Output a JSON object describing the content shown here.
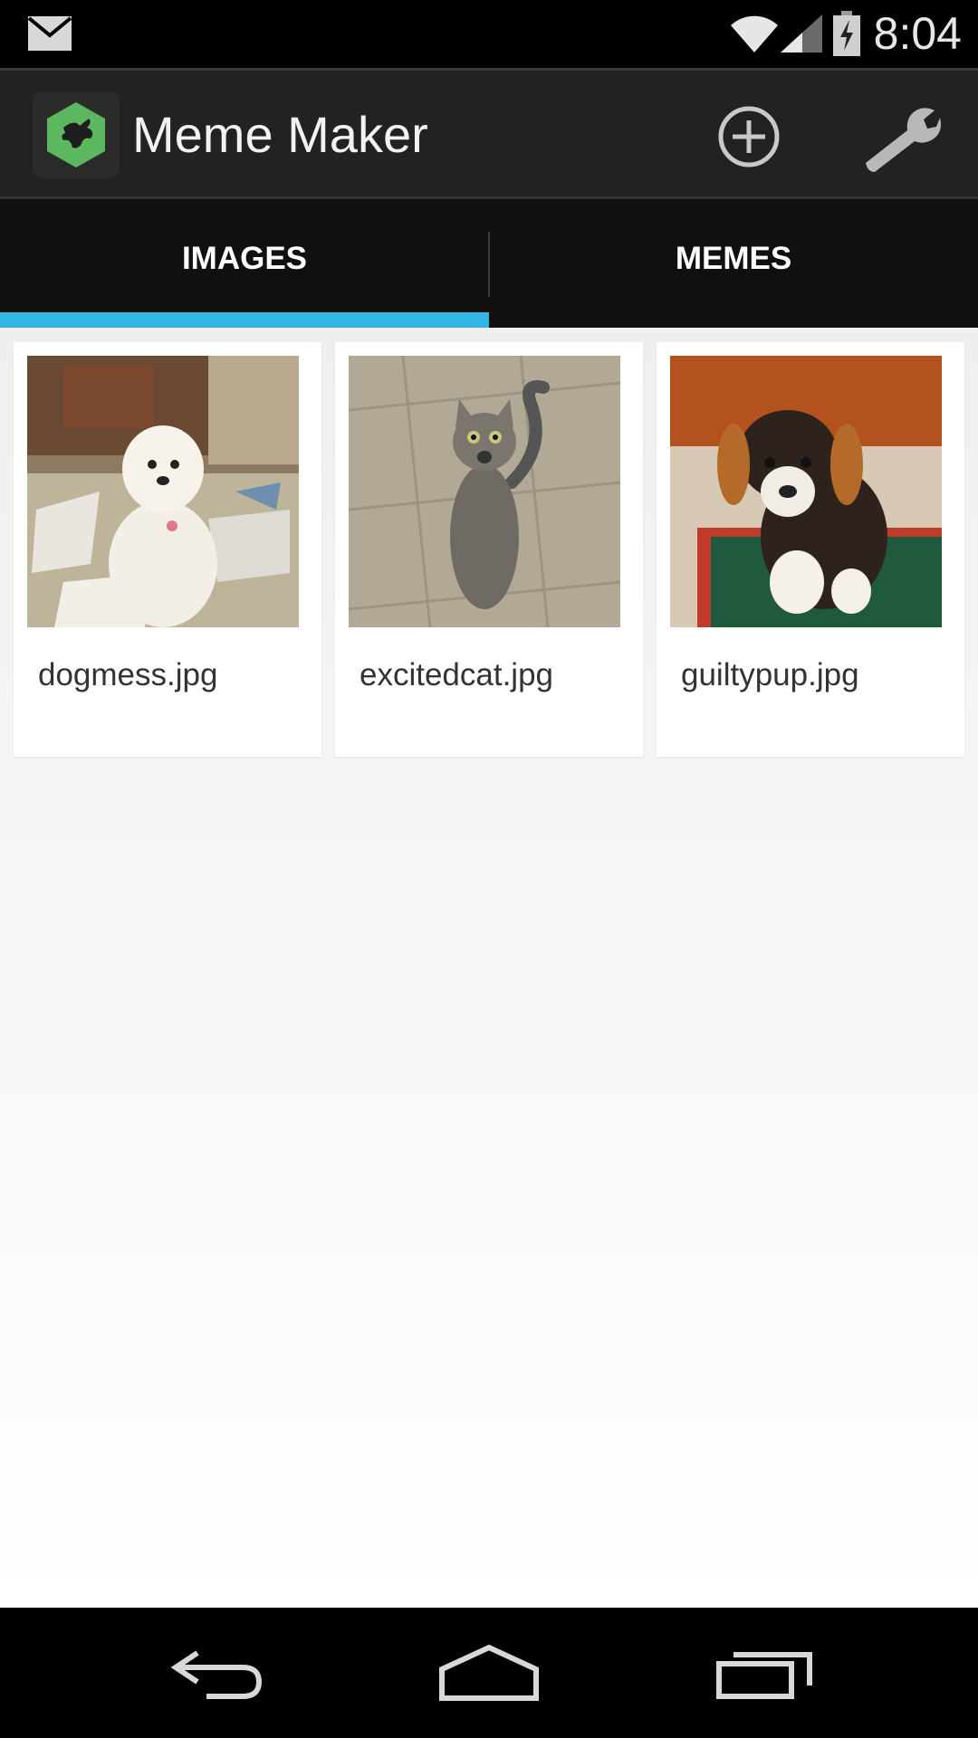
{
  "status_bar": {
    "time": "8:04",
    "icons": [
      "mail-icon",
      "wifi-icon",
      "signal-icon",
      "battery-charging-icon"
    ]
  },
  "action_bar": {
    "title": "Meme Maker",
    "app_icon": "treehouse-logo-icon",
    "actions": [
      "add-icon",
      "wrench-icon"
    ],
    "accent_color": "#5cb860"
  },
  "tabs": {
    "items": [
      {
        "label": "IMAGES",
        "selected": true
      },
      {
        "label": "MEMES",
        "selected": false
      }
    ],
    "indicator_color": "#33b5e5"
  },
  "images": [
    {
      "filename": "dogmess.jpg"
    },
    {
      "filename": "excitedcat.jpg"
    },
    {
      "filename": "guiltypup.jpg"
    }
  ],
  "nav_bar": {
    "buttons": [
      "back-icon",
      "home-icon",
      "recents-icon"
    ]
  }
}
